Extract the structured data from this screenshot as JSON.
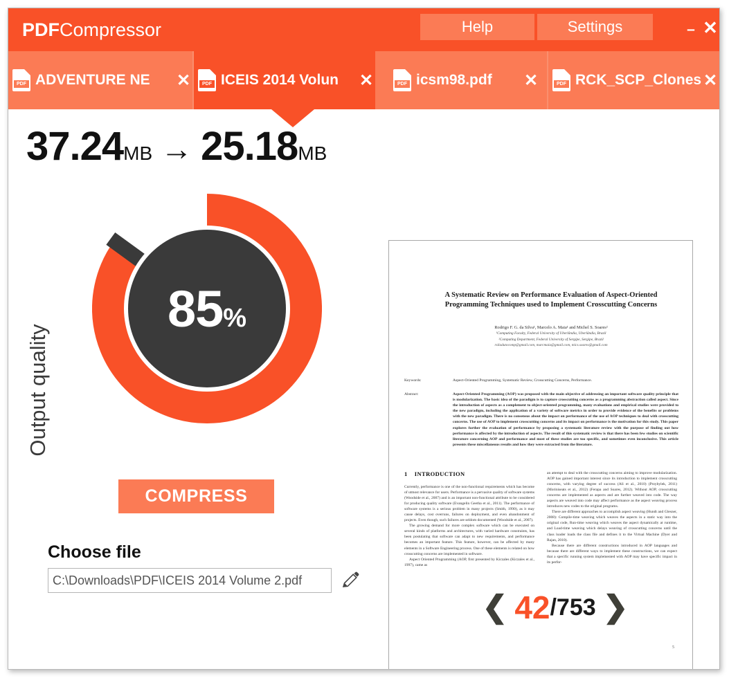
{
  "app": {
    "logo_bold": "PDF",
    "logo_light": "Compressor",
    "accent": "#f95128",
    "accent_light": "#fb7b55",
    "dark": "#3a3a3a"
  },
  "titlebar": {
    "help_label": "Help",
    "settings_label": "Settings",
    "minimize_glyph": "–",
    "close_glyph": "✕"
  },
  "tabs": [
    {
      "label": "ADVENTURE NE",
      "icon": "pdf-file-icon",
      "icon_label": "PDF",
      "close_glyph": "✕",
      "active": false
    },
    {
      "label": "ICEIS 2014 Volun",
      "icon": "pdf-file-icon",
      "icon_label": "PDF",
      "close_glyph": "✕",
      "active": true
    },
    {
      "label": "icsm98.pdf",
      "icon": "pdf-file-icon",
      "icon_label": "PDF",
      "close_glyph": "✕",
      "active": false
    },
    {
      "label": "RCK_SCP_Clones",
      "icon": "pdf-file-icon",
      "icon_label": "PDF",
      "close_glyph": "✕",
      "active": false
    }
  ],
  "sizes": {
    "original_value": "37.24",
    "original_unit": "MB",
    "arrow": "→",
    "compressed_value": "25.18",
    "compressed_unit": "MB"
  },
  "quality": {
    "axis_label": "Output quality",
    "value": "85",
    "suffix": "%",
    "percent": 85
  },
  "actions": {
    "compress_label": "COMPRESS"
  },
  "file": {
    "choose_label": "Choose file",
    "path": "C:\\Downloads\\PDF\\ICEIS 2014 Volume 2.pdf",
    "placeholder": "C:\\Downloads\\PDF\\ICEIS 2014 Volume 2.pdf",
    "edit_icon": "pencil-edit-icon"
  },
  "pager": {
    "prev_glyph": "❮",
    "next_glyph": "❯",
    "current": "42",
    "separator_total": "/753"
  },
  "preview": {
    "title": "A Systematic Review on Performance Evaluation of Aspect-Oriented Programming Techniques used to Implement Crosscutting Concerns",
    "authors": "Rodrigo F. G. da Silva¹, Marcelo A. Maia¹ and Michel S. Soares²",
    "affiliation1": "¹Computing Faculty, Federal University of Uberlândia, Uberlândia, Brazil",
    "affiliation2": "²Computing Department, Federal University of Sergipe, Sergipe, Brazil",
    "emails": "rsiladutocomp@gmail.com, marcmaia@gmail.com, mics.soares@gmail.com",
    "keywords_label": "Keywords:",
    "keywords": "Aspect-Oriented Programming, Systematic Review, Crosscutting Concerns, Performance.",
    "abstract_label": "Abstract:",
    "abstract": "Aspect-Oriented Programming (AOP) was proposed with the main objective of addressing an important software quality principle that is modularization. The basic idea of the paradigm is to capture crosscutting concerns as a programming abstraction called aspect. Since the introduction of aspects as a complement to object-oriented programming, many evaluations and empirical studies were provided to the new paradigm, including the application of a variety of software metrics in order to provide evidence of the benefits or problems with the new paradigm. There is no consensus about the impact on performance of the use of AOP techniques to deal with crosscutting concerns. The use of AOP to implement crosscutting concerns and its impact on performance is the motivation for this study. This paper explores further the evaluation of performance by proposing a systematic literature review with the purpose of finding out how performance is affected by the introduction of aspects. The result of this systematic review is that there has been few studies on scientific literature concerning AOP and performance and most of these studies are too specific, and sometimes even inconclusive. This article presents these miscellaneous results and how they were extracted from the literature.",
    "section_number": "1",
    "section_title": "INTRODUCTION",
    "body_left_1": "Currently, performance is one of the non-functional requirements which has become of utmost relevance for users. Performance is a pervasive quality of software systems (Woodside et al., 2007) and is an important non-functional attribute to be considered for producing quality software (Evangelin Geetha et al., 2011). The performance of software systems is a serious problem in many projects (Smith, 1990), as it may cause delays, cost overruns, failures on deployment, and even abandonment of projects. Even though, such failures are seldom documented (Woodside et al., 2007).",
    "body_left_2": "The growing demand for more complex software which can be executed on several kinds of platforms and architectures, with varied hardware constraints, has been postulating that software can adapt to new requirements, and performance becomes an important feature. This feature, however, can be affected by many elements in a Software Engineering process. One of these elements is related on how crosscutting concerns are implemented in software.",
    "body_left_3": "Aspect Oriented Programming (AOP, first presented by Kiczales (Kiczales et al., 1997), came as",
    "body_right_1": "an attempt to deal with the crosscutting concerns aiming to improve modularization. AOP has gained important interest since its introduction to implement crosscutting concerns, with varying degree of success (Ali et al., 2010) (Przybylek, 2011) (Moriniseats et al., 2012) (Ferapa and Soares, 2012). Without AOP, crosscutting concerns are implemented as aspects and are further weaved into code. The way aspects are weaved into code may affect performance as the aspect weaving process introduces new codes to the original programs.",
    "body_right_2": "There are different approaches to accomplish aspect weaving (Hundt and Glesner, 2008): Compile-time weaving which weaves the aspects in a static way into the original code, Run-time weaving which weaves the aspect dynamically at runtime, and Load-time weaving which delays weaving of crosscutting concerns until the class loader loads the class file and defines it to the Virtual Machine (Dyer and Rajan, 2010).",
    "body_right_3": "Because there are different constructions introduced in AOP languages and because there are different ways to implement these constructions, we can expect that a specific running system implemented with AOP may have specific impact in its perfor-",
    "page_number": "5"
  }
}
